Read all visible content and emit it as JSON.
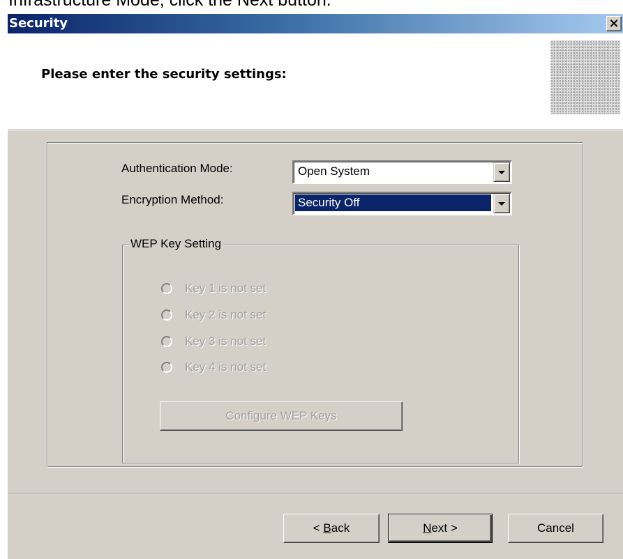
{
  "top_caption": "Infrastructure Mode, click the Next button.",
  "window": {
    "title": "Security",
    "close_glyph": "×"
  },
  "header": {
    "title": "Please enter the security settings:",
    "logo_icon": "noise-pattern-logo"
  },
  "form": {
    "auth_label": "Authentication Mode:",
    "auth_value": "Open System",
    "enc_label": "Encryption Method:",
    "enc_value": "Security Off"
  },
  "wep": {
    "group_label": "WEP Key Setting",
    "keys": [
      "Key 1 is not set",
      "Key 2 is not set",
      "Key 3 is not set",
      "Key 4 is not set"
    ],
    "configure_label": "Configure WEP Keys"
  },
  "footer": {
    "back_prefix": "< ",
    "back_mnemonic": "B",
    "back_rest": "ack",
    "next_mnemonic": "N",
    "next_rest": "ext >",
    "cancel_label": "Cancel"
  }
}
